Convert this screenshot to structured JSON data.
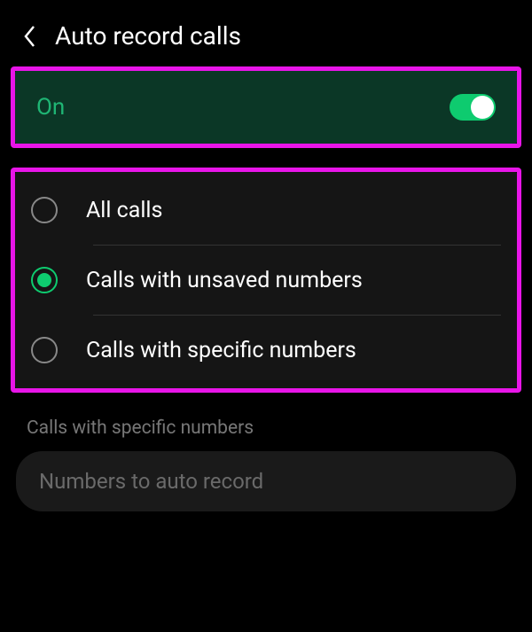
{
  "header": {
    "title": "Auto record calls"
  },
  "toggle": {
    "label": "On",
    "state": true
  },
  "radioOptions": {
    "items": [
      {
        "label": "All calls",
        "selected": false
      },
      {
        "label": "Calls with unsaved numbers",
        "selected": true
      },
      {
        "label": "Calls with specific numbers",
        "selected": false
      }
    ]
  },
  "specificSection": {
    "label": "Calls with specific numbers",
    "placeholder": "Numbers to auto record"
  }
}
